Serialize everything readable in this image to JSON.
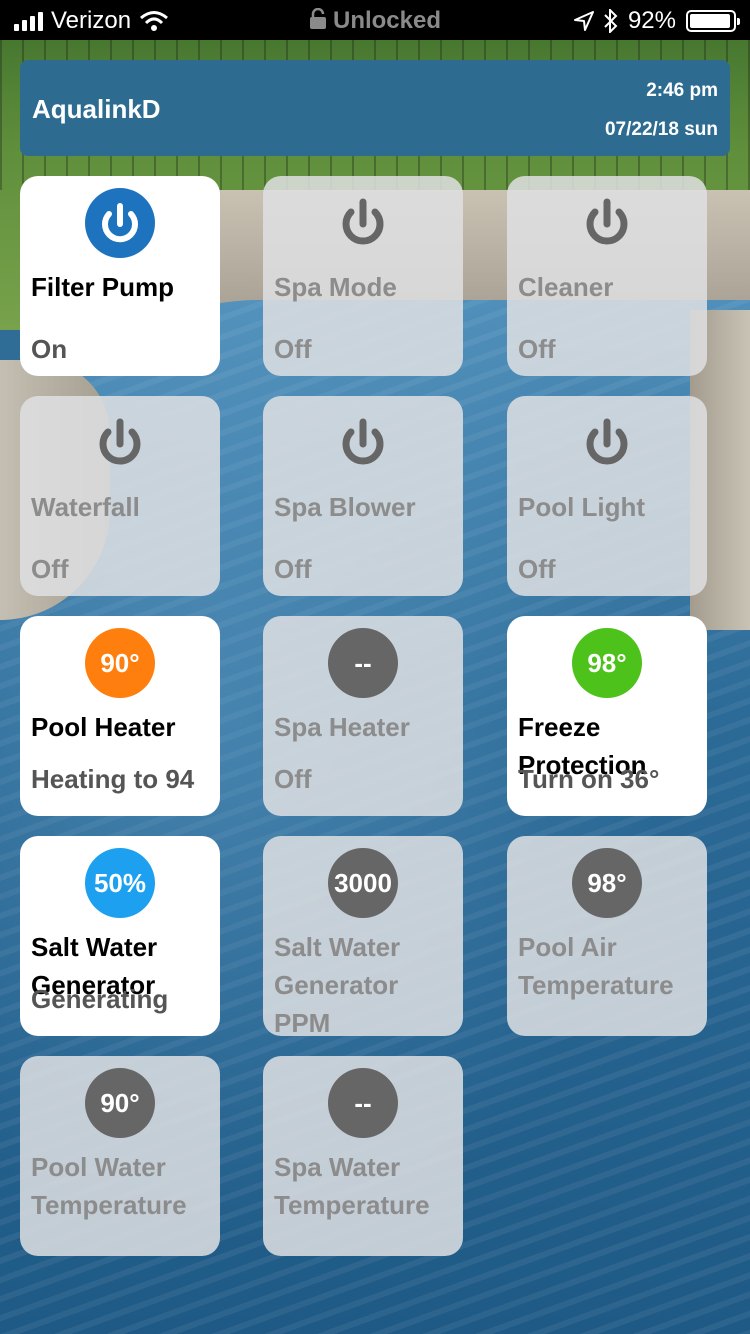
{
  "status_bar": {
    "carrier": "Verizon",
    "lock_text": "Unlocked",
    "battery": "92%"
  },
  "header": {
    "title": "AqualinkD",
    "time": "2:46 pm",
    "date": "07/22/18 sun"
  },
  "colors": {
    "on_tile": "#ffffff",
    "off_tile": "#dedfe1",
    "power_on": "#1e73be",
    "power_off": "#666666",
    "heater_badge": "#ff7f0e",
    "freeze_badge": "#4cc21a",
    "swg_badge": "#1ea0f0",
    "neutral_badge": "#666666"
  },
  "tiles": [
    {
      "name": "Filter Pump",
      "status": "On"
    },
    {
      "name": "Spa Mode",
      "status": "Off"
    },
    {
      "name": "Cleaner",
      "status": "Off"
    },
    {
      "name": "Waterfall",
      "status": "Off"
    },
    {
      "name": "Spa Blower",
      "status": "Off"
    },
    {
      "name": "Pool Light",
      "status": "Off"
    },
    {
      "name": "Pool Heater",
      "status": "Heating to 94",
      "badge": "90°"
    },
    {
      "name": "Spa Heater",
      "status": "Off",
      "badge": "--"
    },
    {
      "name": "Freeze Protection",
      "status": "Turn on 36°",
      "badge": "98°"
    },
    {
      "name": "Salt Water Generator",
      "status": "Generating",
      "badge": "50%"
    },
    {
      "name": "Salt Water Generator PPM",
      "badge": "3000"
    },
    {
      "name": "Pool Air Temperature",
      "badge": "98°"
    },
    {
      "name": "Pool Water Temperature",
      "badge": "90°"
    },
    {
      "name": "Spa Water Temperature",
      "badge": "--"
    }
  ]
}
